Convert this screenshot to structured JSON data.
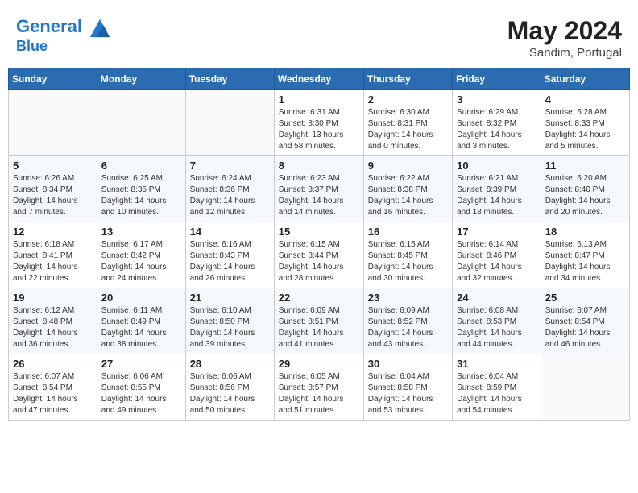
{
  "header": {
    "logo_line1": "General",
    "logo_line2": "Blue",
    "month_year": "May 2024",
    "location": "Sandim, Portugal"
  },
  "days_of_week": [
    "Sunday",
    "Monday",
    "Tuesday",
    "Wednesday",
    "Thursday",
    "Friday",
    "Saturday"
  ],
  "weeks": [
    [
      {
        "num": "",
        "sunrise": "",
        "sunset": "",
        "daylight": ""
      },
      {
        "num": "",
        "sunrise": "",
        "sunset": "",
        "daylight": ""
      },
      {
        "num": "",
        "sunrise": "",
        "sunset": "",
        "daylight": ""
      },
      {
        "num": "1",
        "sunrise": "6:31 AM",
        "sunset": "8:30 PM",
        "daylight": "13 hours and 58 minutes."
      },
      {
        "num": "2",
        "sunrise": "6:30 AM",
        "sunset": "8:31 PM",
        "daylight": "14 hours and 0 minutes."
      },
      {
        "num": "3",
        "sunrise": "6:29 AM",
        "sunset": "8:32 PM",
        "daylight": "14 hours and 3 minutes."
      },
      {
        "num": "4",
        "sunrise": "6:28 AM",
        "sunset": "8:33 PM",
        "daylight": "14 hours and 5 minutes."
      }
    ],
    [
      {
        "num": "5",
        "sunrise": "6:26 AM",
        "sunset": "8:34 PM",
        "daylight": "14 hours and 7 minutes."
      },
      {
        "num": "6",
        "sunrise": "6:25 AM",
        "sunset": "8:35 PM",
        "daylight": "14 hours and 10 minutes."
      },
      {
        "num": "7",
        "sunrise": "6:24 AM",
        "sunset": "8:36 PM",
        "daylight": "14 hours and 12 minutes."
      },
      {
        "num": "8",
        "sunrise": "6:23 AM",
        "sunset": "8:37 PM",
        "daylight": "14 hours and 14 minutes."
      },
      {
        "num": "9",
        "sunrise": "6:22 AM",
        "sunset": "8:38 PM",
        "daylight": "14 hours and 16 minutes."
      },
      {
        "num": "10",
        "sunrise": "6:21 AM",
        "sunset": "8:39 PM",
        "daylight": "14 hours and 18 minutes."
      },
      {
        "num": "11",
        "sunrise": "6:20 AM",
        "sunset": "8:40 PM",
        "daylight": "14 hours and 20 minutes."
      }
    ],
    [
      {
        "num": "12",
        "sunrise": "6:18 AM",
        "sunset": "8:41 PM",
        "daylight": "14 hours and 22 minutes."
      },
      {
        "num": "13",
        "sunrise": "6:17 AM",
        "sunset": "8:42 PM",
        "daylight": "14 hours and 24 minutes."
      },
      {
        "num": "14",
        "sunrise": "6:16 AM",
        "sunset": "8:43 PM",
        "daylight": "14 hours and 26 minutes."
      },
      {
        "num": "15",
        "sunrise": "6:15 AM",
        "sunset": "8:44 PM",
        "daylight": "14 hours and 28 minutes."
      },
      {
        "num": "16",
        "sunrise": "6:15 AM",
        "sunset": "8:45 PM",
        "daylight": "14 hours and 30 minutes."
      },
      {
        "num": "17",
        "sunrise": "6:14 AM",
        "sunset": "8:46 PM",
        "daylight": "14 hours and 32 minutes."
      },
      {
        "num": "18",
        "sunrise": "6:13 AM",
        "sunset": "8:47 PM",
        "daylight": "14 hours and 34 minutes."
      }
    ],
    [
      {
        "num": "19",
        "sunrise": "6:12 AM",
        "sunset": "8:48 PM",
        "daylight": "14 hours and 36 minutes."
      },
      {
        "num": "20",
        "sunrise": "6:11 AM",
        "sunset": "8:49 PM",
        "daylight": "14 hours and 38 minutes."
      },
      {
        "num": "21",
        "sunrise": "6:10 AM",
        "sunset": "8:50 PM",
        "daylight": "14 hours and 39 minutes."
      },
      {
        "num": "22",
        "sunrise": "6:09 AM",
        "sunset": "8:51 PM",
        "daylight": "14 hours and 41 minutes."
      },
      {
        "num": "23",
        "sunrise": "6:09 AM",
        "sunset": "8:52 PM",
        "daylight": "14 hours and 43 minutes."
      },
      {
        "num": "24",
        "sunrise": "6:08 AM",
        "sunset": "8:53 PM",
        "daylight": "14 hours and 44 minutes."
      },
      {
        "num": "25",
        "sunrise": "6:07 AM",
        "sunset": "8:54 PM",
        "daylight": "14 hours and 46 minutes."
      }
    ],
    [
      {
        "num": "26",
        "sunrise": "6:07 AM",
        "sunset": "8:54 PM",
        "daylight": "14 hours and 47 minutes."
      },
      {
        "num": "27",
        "sunrise": "6:06 AM",
        "sunset": "8:55 PM",
        "daylight": "14 hours and 49 minutes."
      },
      {
        "num": "28",
        "sunrise": "6:06 AM",
        "sunset": "8:56 PM",
        "daylight": "14 hours and 50 minutes."
      },
      {
        "num": "29",
        "sunrise": "6:05 AM",
        "sunset": "8:57 PM",
        "daylight": "14 hours and 51 minutes."
      },
      {
        "num": "30",
        "sunrise": "6:04 AM",
        "sunset": "8:58 PM",
        "daylight": "14 hours and 53 minutes."
      },
      {
        "num": "31",
        "sunrise": "6:04 AM",
        "sunset": "8:59 PM",
        "daylight": "14 hours and 54 minutes."
      },
      {
        "num": "",
        "sunrise": "",
        "sunset": "",
        "daylight": ""
      }
    ]
  ],
  "labels": {
    "sunrise_prefix": "Sunrise: ",
    "sunset_prefix": "Sunset: ",
    "daylight_prefix": "Daylight: "
  }
}
